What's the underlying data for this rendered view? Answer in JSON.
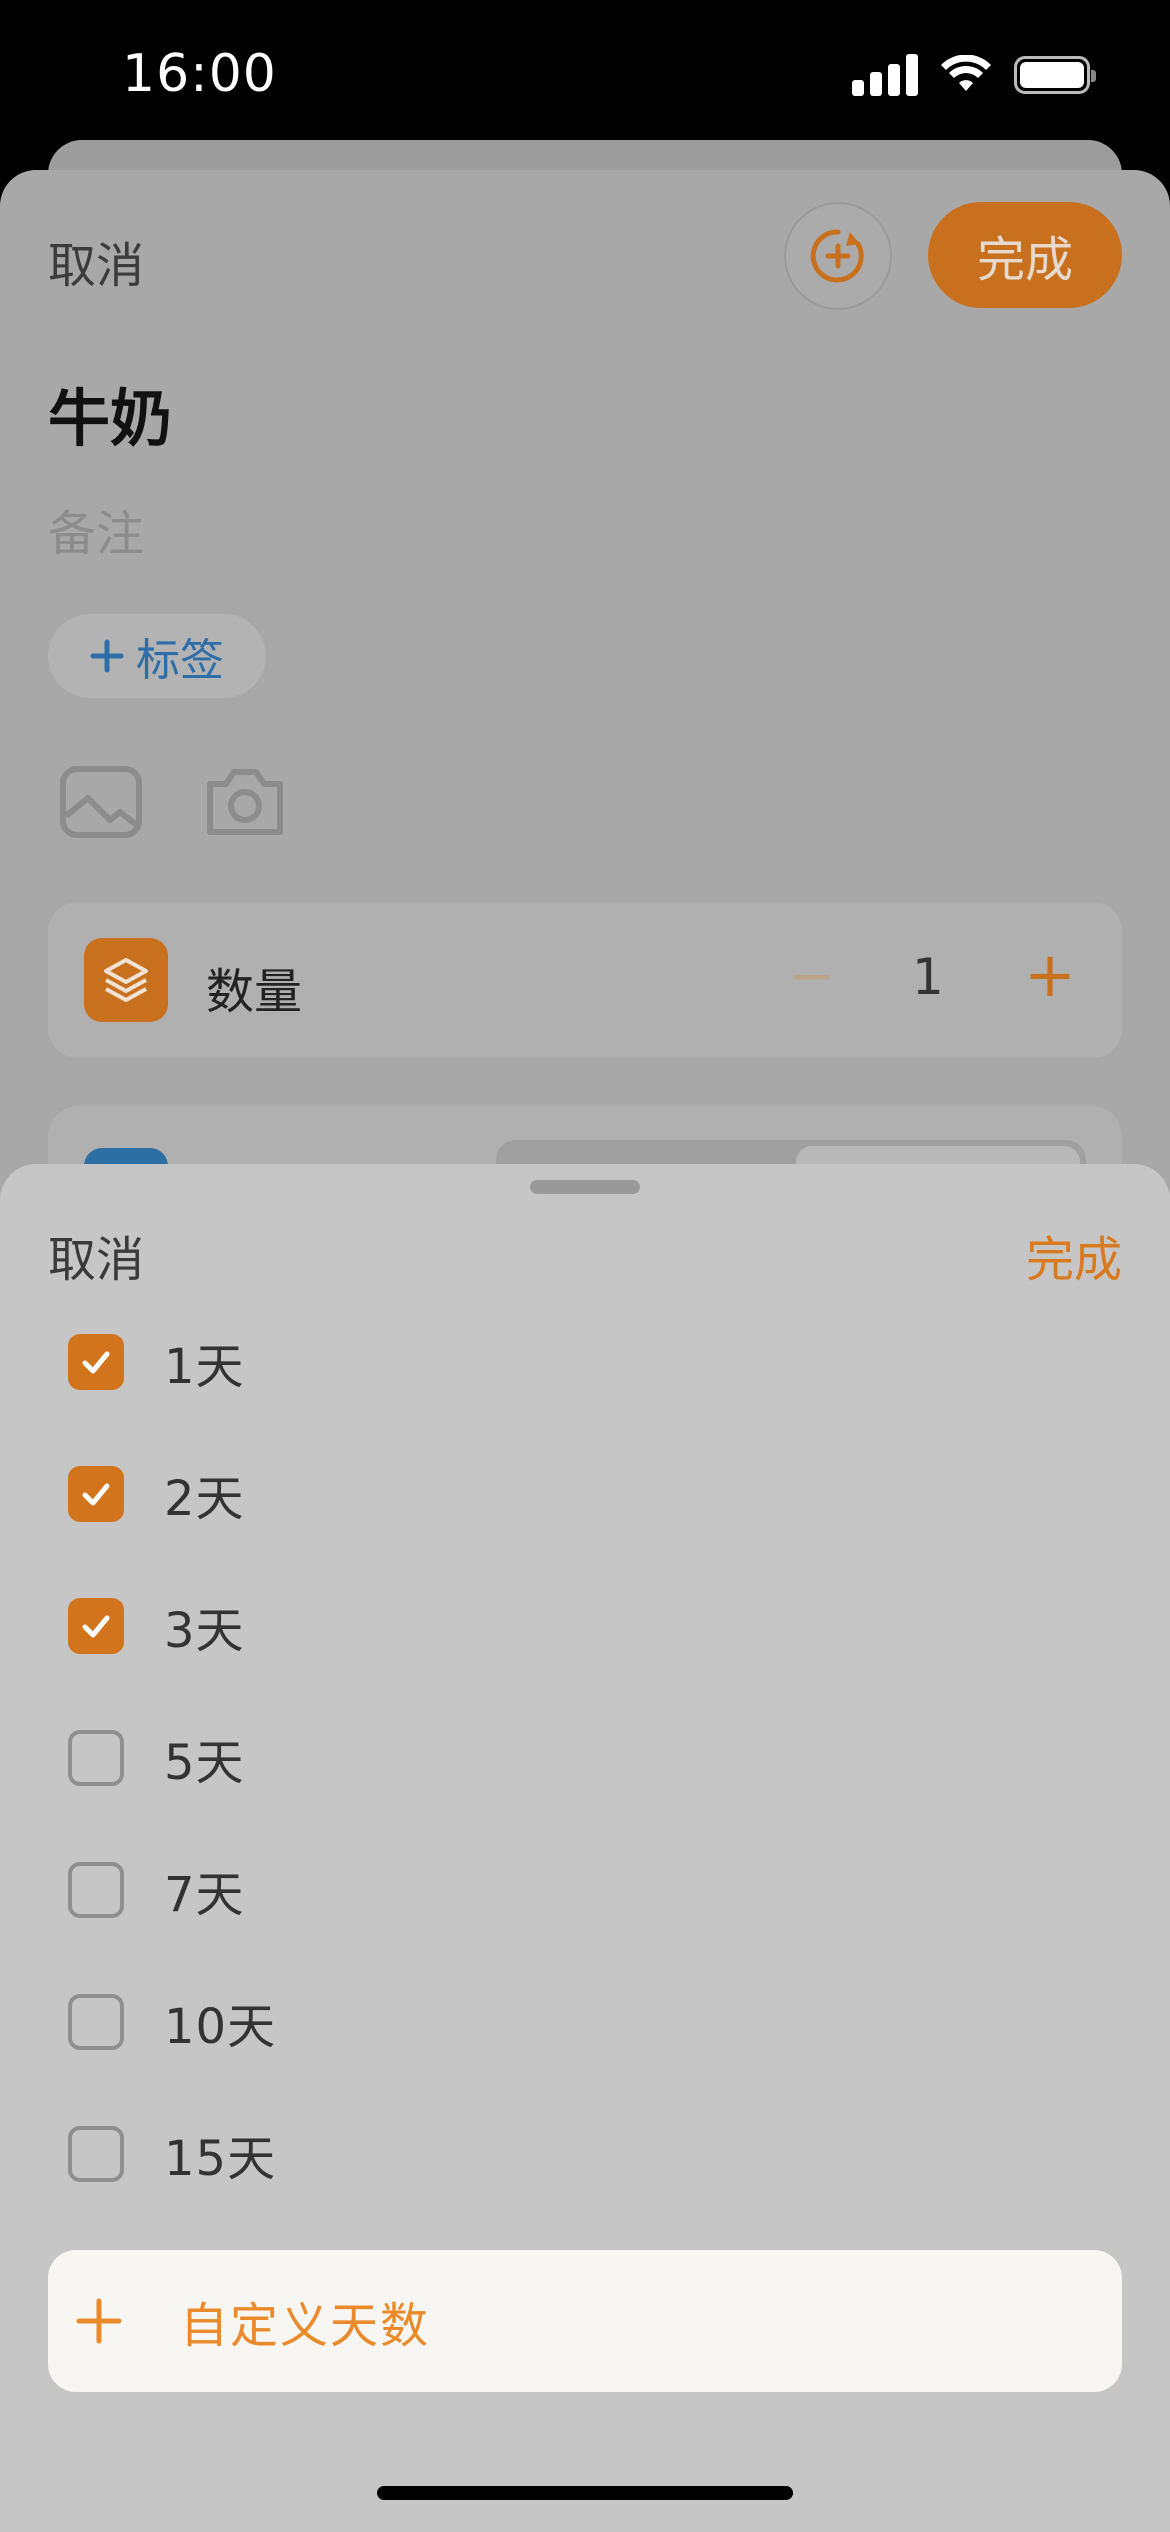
{
  "status_bar": {
    "time": "16:00"
  },
  "background_editor": {
    "cancel_label": "取消",
    "done_label": "完成",
    "item_name": "牛奶",
    "notes_placeholder": "备注",
    "tag_button_label": "标签",
    "quantity": {
      "label": "数量",
      "value": "1",
      "minus_symbol": "−",
      "plus_symbol": "+"
    }
  },
  "picker": {
    "cancel_label": "取消",
    "done_label": "完成",
    "options": [
      {
        "label": "1天",
        "checked": true
      },
      {
        "label": "2天",
        "checked": true
      },
      {
        "label": "3天",
        "checked": true
      },
      {
        "label": "5天",
        "checked": false
      },
      {
        "label": "7天",
        "checked": false
      },
      {
        "label": "10天",
        "checked": false
      },
      {
        "label": "15天",
        "checked": false
      }
    ],
    "custom_days_label": "自定义天数"
  },
  "colors": {
    "accent": "#d2741c",
    "accent_text": "#ea8a2a",
    "tag_blue": "#2d6da8"
  }
}
